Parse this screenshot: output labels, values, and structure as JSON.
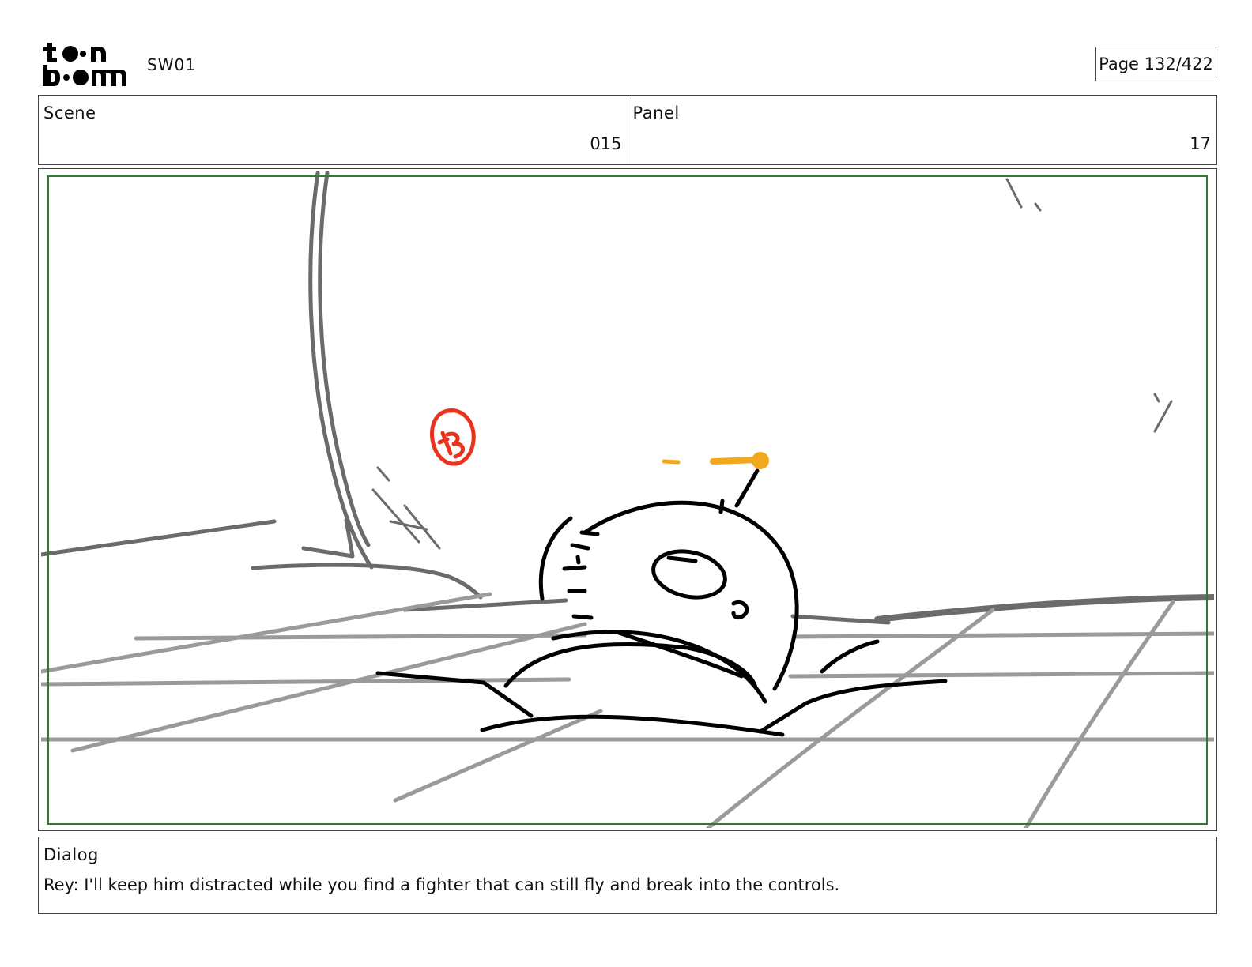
{
  "header": {
    "logo_text": "toon boom",
    "project": "SW01",
    "page": "Page 132/422"
  },
  "info": {
    "scene_label": "Scene",
    "scene_value": "015",
    "panel_label": "Panel",
    "panel_value": "17"
  },
  "sketch": {
    "description_icons": [
      "droid-sketch-icon",
      "floor-grid",
      "annotation-mark"
    ],
    "colors": {
      "ink": "#000000",
      "background_lines": "#6b6b6b",
      "floor_lines": "#9a9a9a",
      "annotation": "#e8341c",
      "antenna": "#f2a81d",
      "safe_frame": "#2e7a2e"
    }
  },
  "dialog": {
    "label": "Dialog",
    "text": "Rey: I'll keep him distracted while you find a fighter that can still fly and break into the controls."
  }
}
